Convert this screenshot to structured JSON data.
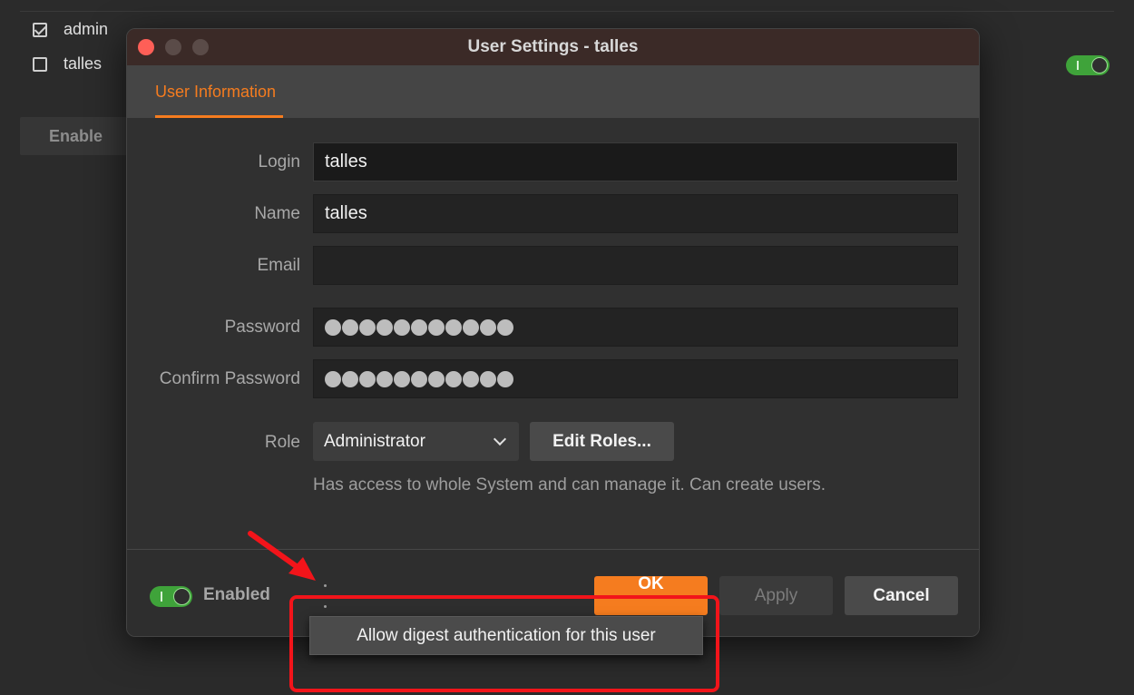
{
  "background": {
    "users": [
      {
        "label": "admin",
        "checked": true
      },
      {
        "label": "talles",
        "checked": false
      }
    ],
    "enable_button": "Enable"
  },
  "dialog": {
    "title": "User Settings - talles",
    "tab": "User Information",
    "fields": {
      "login": {
        "label": "Login",
        "value": "talles"
      },
      "name": {
        "label": "Name",
        "value": "talles"
      },
      "email": {
        "label": "Email",
        "value": ""
      },
      "password": {
        "label": "Password",
        "masked_length": 11
      },
      "confirm_password": {
        "label": "Confirm Password",
        "masked_length": 11
      }
    },
    "role": {
      "label": "Role",
      "selected": "Administrator",
      "edit_button": "Edit Roles...",
      "description": "Has access to whole System and can manage it. Can create users."
    },
    "footer": {
      "enabled_label": "Enabled",
      "ok": "OK",
      "apply": "Apply",
      "cancel": "Cancel"
    },
    "context_menu": {
      "item": "Allow digest authentication for this user"
    }
  },
  "colors": {
    "accent": "#f57c1f",
    "toggle_on": "#3fa33a",
    "annotation": "#f2141a"
  }
}
